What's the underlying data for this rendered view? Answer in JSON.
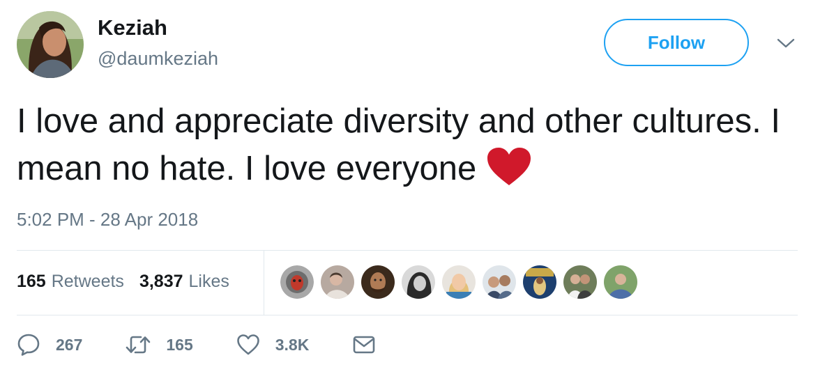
{
  "author": {
    "name": "Keziah",
    "handle": "@daumkeziah",
    "follow_label": "Follow"
  },
  "tweet": {
    "text": "I love and appreciate diversity and other cultures. I mean no hate. I love everyone",
    "emoji": "red-heart",
    "timestamp": "5:02 PM - 28 Apr 2018"
  },
  "stats": {
    "retweets_count": "165",
    "retweets_label": "Retweets",
    "likes_count": "3,837",
    "likes_label": "Likes"
  },
  "liker_avatars": [
    "avatar-1",
    "avatar-2",
    "avatar-3",
    "avatar-4",
    "avatar-5",
    "avatar-6",
    "avatar-7",
    "avatar-8",
    "avatar-9"
  ],
  "actions": {
    "replies": "267",
    "retweets": "165",
    "likes": "3.8K"
  },
  "colors": {
    "accent": "#1da1f2",
    "muted": "#657786",
    "heart": "#d0192b"
  }
}
